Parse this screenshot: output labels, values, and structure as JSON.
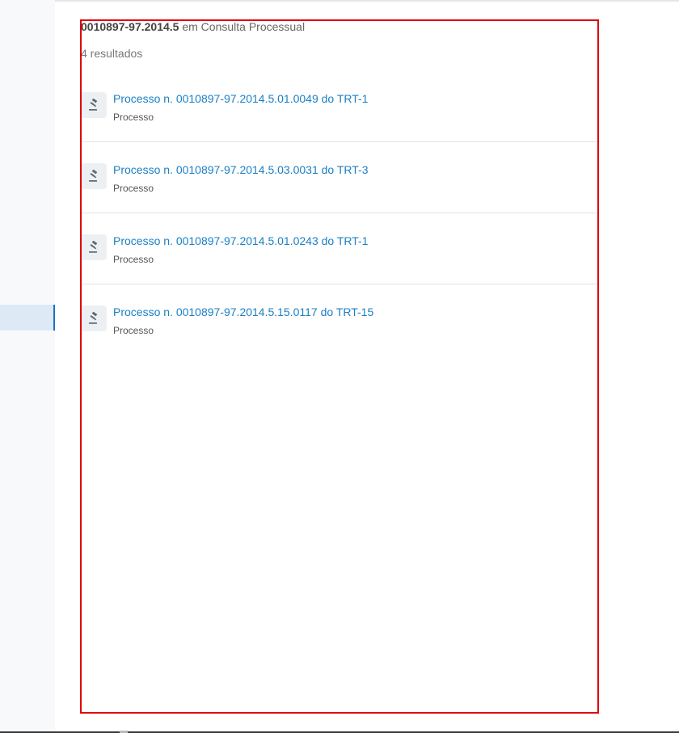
{
  "search": {
    "term": "0010897-97.2014.5",
    "scope_text": "em Consulta Processual",
    "result_count": "4 resultados"
  },
  "results": [
    {
      "title": "Processo n. 0010897-97.2014.5.01.0049 do TRT-1",
      "type": "Processo",
      "icon": "gavel-icon"
    },
    {
      "title": "Processo n. 0010897-97.2014.5.03.0031 do TRT-3",
      "type": "Processo",
      "icon": "gavel-icon"
    },
    {
      "title": "Processo n. 0010897-97.2014.5.01.0243 do TRT-1",
      "type": "Processo",
      "icon": "gavel-icon"
    },
    {
      "title": "Processo n. 0010897-97.2014.5.15.0117 do TRT-15",
      "type": "Processo",
      "icon": "gavel-icon"
    }
  ],
  "colors": {
    "link": "#1a7fc4",
    "highlight_border": "#e0000a",
    "sidebar_active": "#dde9f5",
    "sidebar_active_bar": "#1a73c4"
  }
}
